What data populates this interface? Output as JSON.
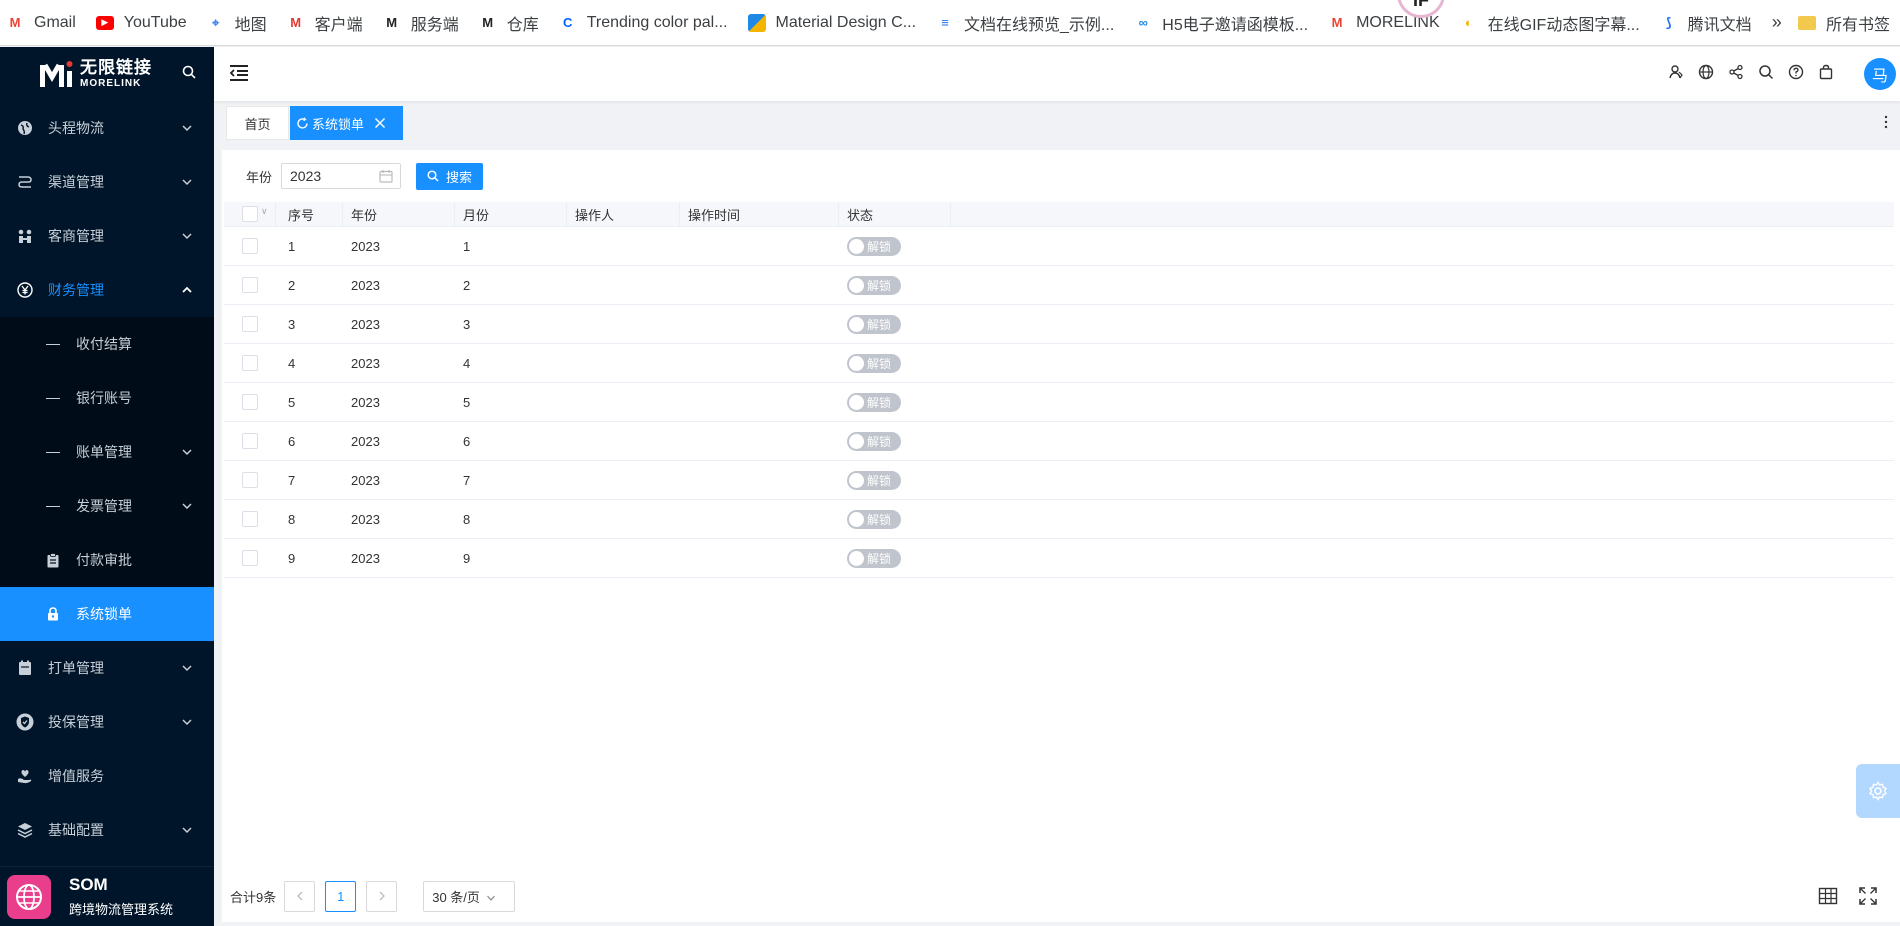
{
  "bookmarks": [
    {
      "label": "Gmail",
      "icon": "gmail-icon",
      "color": "#ea4335"
    },
    {
      "label": "YouTube",
      "icon": "youtube-icon",
      "color": "#ff0000"
    },
    {
      "label": "地图",
      "icon": "map-icon",
      "color": "#4285f4"
    },
    {
      "label": "客户端",
      "icon": "morelink-icon",
      "color": "#e53935"
    },
    {
      "label": "服务端",
      "icon": "morelink-icon",
      "color": "#222"
    },
    {
      "label": "仓库",
      "icon": "morelink-icon",
      "color": "#222"
    },
    {
      "label": "Trending color pal...",
      "icon": "coolors-icon",
      "color": "#0066ff"
    },
    {
      "label": "Material Design C...",
      "icon": "material-icon",
      "color": "#2196f3"
    },
    {
      "label": "文档在线预览_示例...",
      "icon": "doc-icon",
      "color": "#1a73e8"
    },
    {
      "label": "H5电子邀请函模板...",
      "icon": "infinity-icon",
      "color": "#1e88e5"
    },
    {
      "label": "MORELINK",
      "icon": "gmail-icon",
      "color": "#ea4335"
    },
    {
      "label": "在线GIF动态图字幕...",
      "icon": "gif-icon",
      "color": "#f4b400"
    },
    {
      "label": "腾讯文档",
      "icon": "tencent-docs-icon",
      "color": "#1e6fff"
    }
  ],
  "bookmarks_more": "»",
  "bookmarks_folder": "所有书签",
  "extension_badge": "IF",
  "sidebar": {
    "logo_cn": "无限链接",
    "logo_en": "MORELINK",
    "menu": [
      {
        "label": "头程物流",
        "icon": "globe-icon",
        "expandable": true
      },
      {
        "label": "渠道管理",
        "icon": "route-icon",
        "expandable": true
      },
      {
        "label": "客商管理",
        "icon": "users-icon",
        "expandable": true
      },
      {
        "label": "财务管理",
        "icon": "yen-icon",
        "expandable": true,
        "open": true
      }
    ],
    "finance_sub": [
      {
        "label": "收付结算"
      },
      {
        "label": "银行账号"
      },
      {
        "label": "账单管理"
      },
      {
        "label": "发票管理"
      },
      {
        "label": "付款审批"
      },
      {
        "label": "系统锁单"
      }
    ],
    "menu_after": [
      {
        "label": "打单管理",
        "icon": "print-icon"
      },
      {
        "label": "投保管理",
        "icon": "shield-icon"
      },
      {
        "label": "增值服务",
        "icon": "heart-hand-icon"
      },
      {
        "label": "基础配置",
        "icon": "layers-icon"
      }
    ],
    "brand_title": "SOM",
    "brand_sub": "跨境物流管理系统"
  },
  "header": {
    "avatar_text": "马"
  },
  "tabs": {
    "home": "首页",
    "active": "系统锁单"
  },
  "filter": {
    "year_label": "年份",
    "year_value": "2023",
    "search_label": "搜索"
  },
  "table": {
    "columns": [
      "序号",
      "年份",
      "月份",
      "操作人",
      "操作时间",
      "状态"
    ],
    "toggle_label": "解锁",
    "rows": [
      {
        "idx": "1",
        "year": "2023",
        "month": "1",
        "operator": "",
        "time": ""
      },
      {
        "idx": "2",
        "year": "2023",
        "month": "2",
        "operator": "",
        "time": ""
      },
      {
        "idx": "3",
        "year": "2023",
        "month": "3",
        "operator": "",
        "time": ""
      },
      {
        "idx": "4",
        "year": "2023",
        "month": "4",
        "operator": "",
        "time": ""
      },
      {
        "idx": "5",
        "year": "2023",
        "month": "5",
        "operator": "",
        "time": ""
      },
      {
        "idx": "6",
        "year": "2023",
        "month": "6",
        "operator": "",
        "time": ""
      },
      {
        "idx": "7",
        "year": "2023",
        "month": "7",
        "operator": "",
        "time": ""
      },
      {
        "idx": "8",
        "year": "2023",
        "month": "8",
        "operator": "",
        "time": ""
      },
      {
        "idx": "9",
        "year": "2023",
        "month": "9",
        "operator": "",
        "time": ""
      }
    ]
  },
  "pagination": {
    "total": "合计9条",
    "current_page": "1",
    "page_size": "30 条/页"
  },
  "colors": {
    "primary": "#1890ff",
    "sidebar_bg": "#001529",
    "brand_pink": "#e83e8c"
  }
}
